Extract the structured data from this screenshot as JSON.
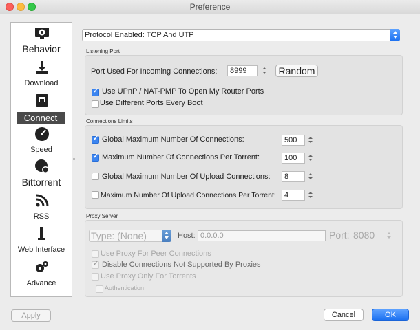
{
  "window": {
    "title": "Preference"
  },
  "sidebar": {
    "items": [
      {
        "label": "Behavior",
        "icon": "gear-monitor-icon"
      },
      {
        "label": "Download",
        "icon": "download-icon"
      },
      {
        "label": "Connect",
        "icon": "network-port-icon"
      },
      {
        "label": "Speed",
        "icon": "speedometer-icon"
      },
      {
        "label": "Bittorrent",
        "icon": "globe-gear-icon"
      },
      {
        "label": "RSS",
        "icon": "rss-icon"
      },
      {
        "label": "Web Interface",
        "icon": "plug-icon"
      },
      {
        "label": "Advance",
        "icon": "gears-icon"
      }
    ],
    "selected": "Connect"
  },
  "protocol": {
    "label": "Protocol Enabled: TCP And UTP"
  },
  "listening": {
    "title": "Listening Port",
    "port_label": "Port Used For Incoming Connections:",
    "port_value": "8999",
    "random_label": "Random",
    "upnp_label": "Use UPnP / NAT-PMP To Open My Router Ports",
    "upnp_checked": true,
    "diff_ports_label": "Use Different Ports Every Boot",
    "diff_ports_checked": false
  },
  "limits": {
    "title": "Connections Limits",
    "rows": [
      {
        "label": "Global Maximum Number Of Connections:",
        "value": "500",
        "checked": true
      },
      {
        "label": "Maximum Number Of Connections Per Torrent:",
        "value": "100",
        "checked": true
      },
      {
        "label": "Global Maximum Number Of Upload Connections:",
        "value": "8",
        "checked": false
      },
      {
        "label": "Maximum Number Of Upload Connections Per Torrent:",
        "value": "4",
        "checked": false
      }
    ]
  },
  "proxy": {
    "title": "Proxy Server",
    "type_label": "Type: (None)",
    "host_label": "Host:",
    "host_value": "0.0.0.0",
    "port_label": "Port:",
    "port_value": "8080",
    "peer_label": "Use Proxy For Peer Connections",
    "disable_label": "Disable Connections Not Supported By Proxies",
    "torrents_label": "Use Proxy Only For Torrents",
    "auth_label": "Authentication"
  },
  "footer": {
    "apply": "Apply",
    "cancel": "Cancel",
    "ok": "OK"
  },
  "colors": {
    "accent": "#1a6ff0",
    "selected_sidebar": "#4a4a4a"
  }
}
